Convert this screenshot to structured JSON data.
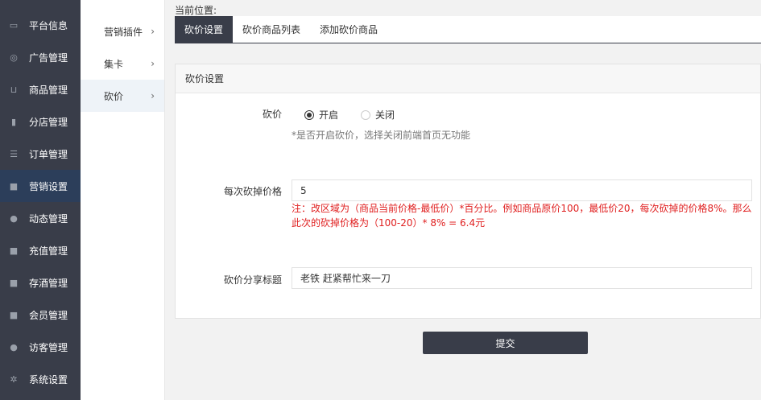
{
  "sidebar": {
    "items": [
      {
        "label": "平台信息",
        "icon": "card-icon"
      },
      {
        "label": "广告管理",
        "icon": "lifebuoy-icon"
      },
      {
        "label": "商品管理",
        "icon": "cart-icon"
      },
      {
        "label": "分店管理",
        "icon": "building-icon"
      },
      {
        "label": "订单管理",
        "icon": "list-icon"
      },
      {
        "label": "营销设置",
        "icon": "gift-icon"
      },
      {
        "label": "动态管理",
        "icon": "user-icon"
      },
      {
        "label": "充值管理",
        "icon": "gift-icon"
      },
      {
        "label": "存酒管理",
        "icon": "gift-icon"
      },
      {
        "label": "会员管理",
        "icon": "gift-icon"
      },
      {
        "label": "访客管理",
        "icon": "user-icon"
      },
      {
        "label": "系统设置",
        "icon": "gear-icon"
      }
    ],
    "active_index": 5
  },
  "subnav": {
    "items": [
      {
        "label": "营销插件"
      },
      {
        "label": "集卡"
      },
      {
        "label": "砍价"
      }
    ],
    "active_index": 2
  },
  "breadcrumb": {
    "label": "当前位置:"
  },
  "tabs": [
    {
      "label": "砍价设置"
    },
    {
      "label": "砍价商品列表"
    },
    {
      "label": "添加砍价商品"
    }
  ],
  "panel": {
    "title": "砍价设置",
    "bargain": {
      "label": "砍价",
      "option_on": "开启",
      "option_off": "关闭",
      "hint": "*是否开启砍价，选择关闭前端首页无功能"
    },
    "cut_price": {
      "label": "每次砍掉价格",
      "value": "5",
      "note_line1": "注：改区域为（商品当前价格-最低价）*百分比。例如商品原价100，最低价20，每次砍掉的价格8%。那么",
      "note_line2": "此次的砍掉价格为（100-20）* 8% = 6.4元"
    },
    "share_title": {
      "label": "砍价分享标题",
      "value": "老铁 赶紧帮忙来一刀"
    }
  },
  "submit_label": "提交"
}
